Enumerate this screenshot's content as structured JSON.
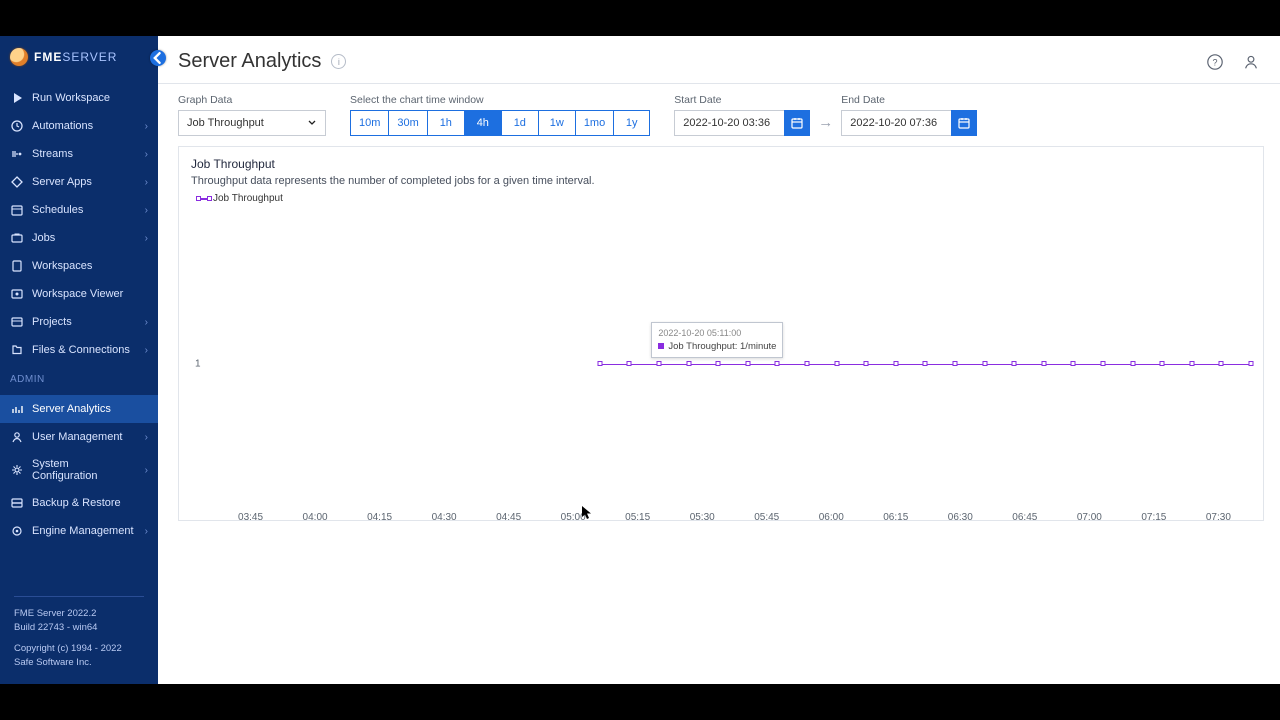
{
  "brand": {
    "bold": "FME",
    "light": "SERVER"
  },
  "nav": {
    "items": [
      {
        "label": "Run Workspace",
        "icon": "play",
        "chev": false
      },
      {
        "label": "Automations",
        "icon": "automation",
        "chev": true
      },
      {
        "label": "Streams",
        "icon": "streams",
        "chev": true
      },
      {
        "label": "Server Apps",
        "icon": "apps",
        "chev": true
      },
      {
        "label": "Schedules",
        "icon": "schedule",
        "chev": true
      },
      {
        "label": "Jobs",
        "icon": "jobs",
        "chev": true
      },
      {
        "label": "Workspaces",
        "icon": "workspaces",
        "chev": false
      },
      {
        "label": "Workspace Viewer",
        "icon": "viewer",
        "chev": false
      },
      {
        "label": "Projects",
        "icon": "projects",
        "chev": true
      },
      {
        "label": "Files & Connections",
        "icon": "files",
        "chev": true
      }
    ],
    "admin_label": "ADMIN",
    "admin_items": [
      {
        "label": "Server Analytics",
        "icon": "analytics",
        "chev": false,
        "active": true
      },
      {
        "label": "User Management",
        "icon": "users",
        "chev": true
      },
      {
        "label": "System Configuration",
        "icon": "config",
        "chev": true
      },
      {
        "label": "Backup & Restore",
        "icon": "backup",
        "chev": false
      },
      {
        "label": "Engine Management",
        "icon": "engine",
        "chev": true
      }
    ]
  },
  "footer": {
    "line1": "FME Server 2022.2",
    "line2": "Build 22743 - win64",
    "line3": "Copyright (c) 1994 - 2022",
    "line4": "Safe Software Inc."
  },
  "header": {
    "title": "Server Analytics"
  },
  "controls": {
    "graph_data_label": "Graph Data",
    "graph_data_value": "Job Throughput",
    "time_window_label": "Select the chart time window",
    "time_buttons": [
      "10m",
      "30m",
      "1h",
      "4h",
      "1d",
      "1w",
      "1mo",
      "1y"
    ],
    "time_active": "4h",
    "start_label": "Start Date",
    "start_value": "2022-10-20 03:36",
    "end_label": "End Date",
    "end_value": "2022-10-20 07:36"
  },
  "chart": {
    "title": "Job Throughput",
    "subtitle": "Throughput data represents the number of completed jobs for a given time interval.",
    "legend": "Job Throughput",
    "yticks": [
      "1"
    ],
    "xticks": [
      "03:45",
      "04:00",
      "04:15",
      "04:30",
      "04:45",
      "05:00",
      "05:15",
      "05:30",
      "05:45",
      "06:00",
      "06:15",
      "06:30",
      "06:45",
      "07:00",
      "07:15",
      "07:30"
    ],
    "tooltip": {
      "ts": "2022-10-20 05:11:00",
      "series": "Job Throughput",
      "value": "1/minute"
    }
  },
  "chart_data": {
    "type": "line",
    "title": "Job Throughput",
    "xlabel": "",
    "ylabel": "",
    "ylim": [
      0,
      2
    ],
    "x_range": [
      "03:36",
      "07:36"
    ],
    "series": [
      {
        "name": "Job Throughput",
        "unit": "/minute",
        "color": "#8a2de0",
        "x": [
          "05:07",
          "05:11",
          "05:15",
          "05:22",
          "05:29",
          "05:36",
          "05:43",
          "05:50",
          "05:57",
          "06:04",
          "06:11",
          "06:18",
          "06:25",
          "06:32",
          "06:39",
          "06:46",
          "06:53",
          "07:00",
          "07:07",
          "07:14",
          "07:21",
          "07:28",
          "07:36"
        ],
        "values": [
          1,
          1,
          1,
          1,
          1,
          1,
          1,
          1,
          1,
          1,
          1,
          1,
          1,
          1,
          1,
          1,
          1,
          1,
          1,
          1,
          1,
          1,
          1
        ]
      }
    ],
    "x_ticks": [
      "03:45",
      "04:00",
      "04:15",
      "04:30",
      "04:45",
      "05:00",
      "05:15",
      "05:30",
      "05:45",
      "06:00",
      "06:15",
      "06:30",
      "06:45",
      "07:00",
      "07:15",
      "07:30"
    ]
  }
}
